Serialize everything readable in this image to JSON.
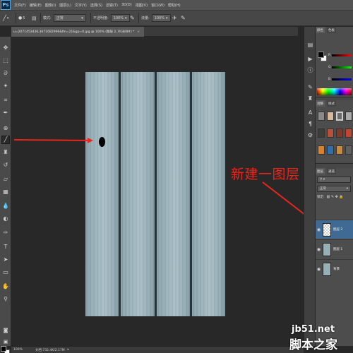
{
  "app": {
    "logo": "Ps"
  },
  "menu": [
    "文件(F)",
    "编辑(E)",
    "图像(I)",
    "图层(L)",
    "文字(Y)",
    "选择(S)",
    "滤镜(T)",
    "3D(D)",
    "视图(V)",
    "窗口(W)",
    "帮助(H)"
  ],
  "options": {
    "brush_size": "5",
    "mode_label": "模式:",
    "mode_value": "正常",
    "opacity_label": "不透明度:",
    "opacity_value": "100%",
    "flow_label": "流量:",
    "flow_value": "100%"
  },
  "document": {
    "tab_title": "u=2071453436,3671682996&fm=21&gp=0.jpg @ 100% (图层 2, RGB/8#) *",
    "close_glyph": "×"
  },
  "toolbar": {
    "icons": [
      "move-tool-icon",
      "marquee-tool-icon",
      "lasso-tool-icon",
      "quick-select-tool-icon",
      "crop-tool-icon",
      "eyedropper-tool-icon",
      "healing-brush-tool-icon",
      "brush-tool-icon",
      "clone-stamp-tool-icon",
      "history-brush-tool-icon",
      "eraser-tool-icon",
      "gradient-tool-icon",
      "blur-tool-icon",
      "dodge-tool-icon",
      "pen-tool-icon",
      "type-tool-icon",
      "path-select-tool-icon",
      "rectangle-tool-icon",
      "hand-tool-icon",
      "zoom-tool-icon"
    ],
    "active": "brush-tool-icon"
  },
  "annotation": {
    "text": "新建一图层"
  },
  "layers_panel": {
    "tab_labels": [
      "图层",
      "通道"
    ],
    "blend_mode": "正常",
    "opacity_label": "不透明度:",
    "fill_label": "填充:",
    "lock_label": "锁定:",
    "layers": [
      {
        "name": "图层 2",
        "selected": true
      },
      {
        "name": "图层 1",
        "selected": false
      },
      {
        "name": "背景",
        "selected": false
      }
    ]
  },
  "color_panel": {
    "tab_labels": [
      "颜色",
      "色板"
    ],
    "slider_labels": [
      "R",
      "G",
      "B"
    ]
  },
  "swatch_panel": {
    "tab_labels": [
      "调整",
      "样式"
    ]
  },
  "statusbar": {
    "zoom": "100%",
    "doc_info": "文档:732.4K/2.17M"
  },
  "watermark": {
    "url": "jb51.net",
    "name": "脚本之家"
  },
  "colors": {
    "accent_red": "#e8261c",
    "wood": "#9fb6be",
    "selection_blue": "#3f6a93"
  }
}
